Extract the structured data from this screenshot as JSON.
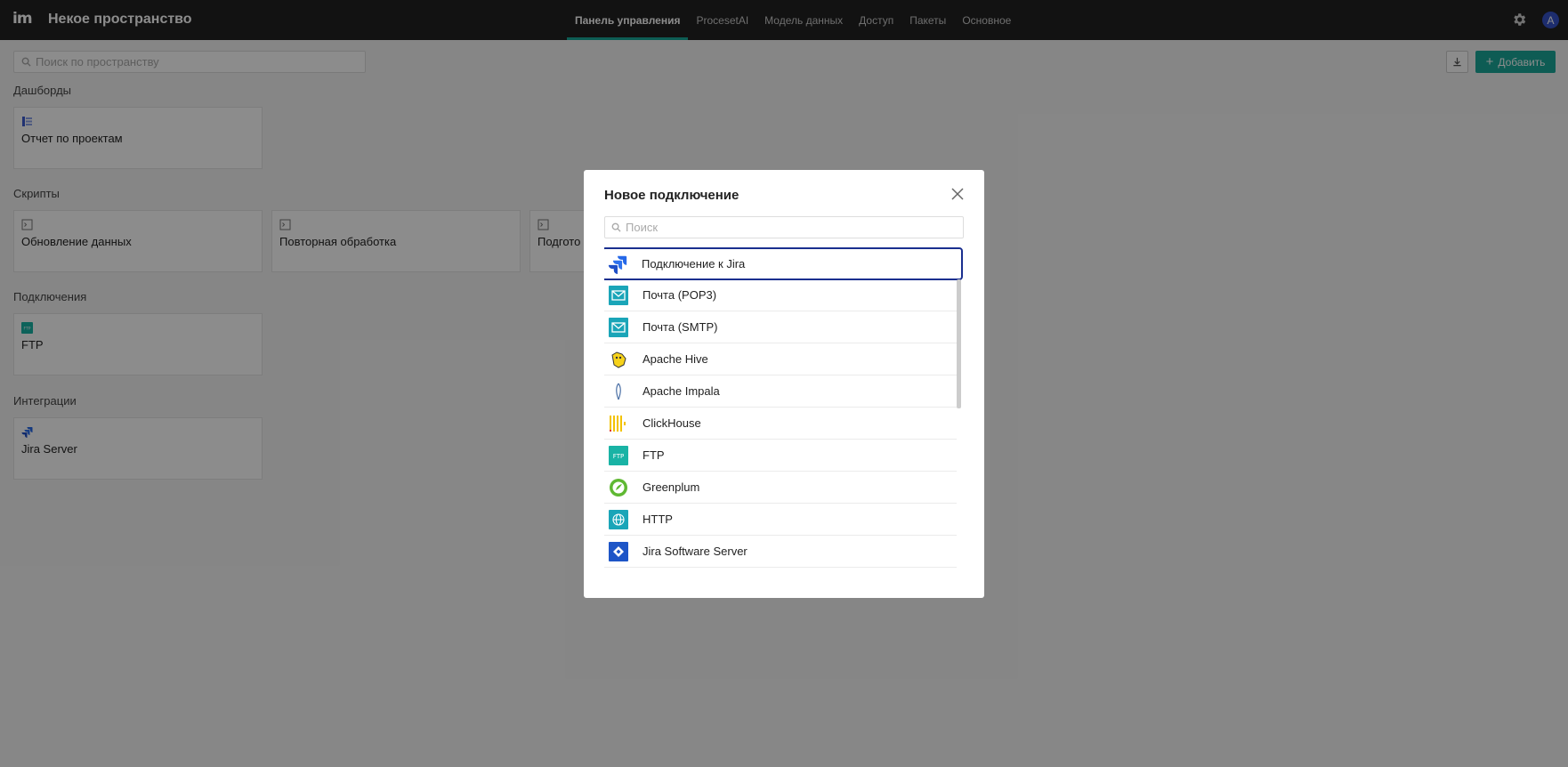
{
  "app": {
    "logo": "im",
    "space_title": "Некое пространство"
  },
  "nav": {
    "tabs": [
      {
        "label": "Панель управления",
        "active": true
      },
      {
        "label": "ProcesetAI",
        "active": false
      },
      {
        "label": "Модель данных",
        "active": false
      },
      {
        "label": "Доступ",
        "active": false
      },
      {
        "label": "Пакеты",
        "active": false
      },
      {
        "label": "Основное",
        "active": false
      }
    ],
    "avatar_initial": "A"
  },
  "toolbar": {
    "search_placeholder": "Поиск по пространству",
    "add_label": "Добавить"
  },
  "sections": {
    "dashboards": {
      "title": "Дашборды",
      "items": [
        "Отчет по проектам"
      ]
    },
    "scripts": {
      "title": "Скрипты",
      "items": [
        "Обновление данных",
        "Повторная обработка",
        "Подгото"
      ]
    },
    "connections": {
      "title": "Подключения",
      "items": [
        "FTP"
      ]
    },
    "integrations": {
      "title": "Интеграции",
      "items": [
        "Jira Server"
      ]
    }
  },
  "modal": {
    "title": "Новое подключение",
    "search_placeholder": "Поиск",
    "items": [
      {
        "label": "Подключение к Jira",
        "icon": "jira-icon",
        "selected": true
      },
      {
        "label": "Почта (POP3)",
        "icon": "mail-icon"
      },
      {
        "label": "Почта (SMTP)",
        "icon": "mail-icon"
      },
      {
        "label": "Apache Hive",
        "icon": "hive-icon"
      },
      {
        "label": "Apache Impala",
        "icon": "impala-icon"
      },
      {
        "label": "ClickHouse",
        "icon": "clickhouse-icon"
      },
      {
        "label": "FTP",
        "icon": "ftp-icon"
      },
      {
        "label": "Greenplum",
        "icon": "greenplum-icon"
      },
      {
        "label": "HTTP",
        "icon": "globe-icon"
      },
      {
        "label": "Jira Software Server",
        "icon": "jira-software-icon"
      }
    ]
  },
  "colors": {
    "accent": "#1aa89a",
    "topbar": "#222222",
    "selected_border": "#1a2f8f",
    "avatar": "#3552c8"
  }
}
